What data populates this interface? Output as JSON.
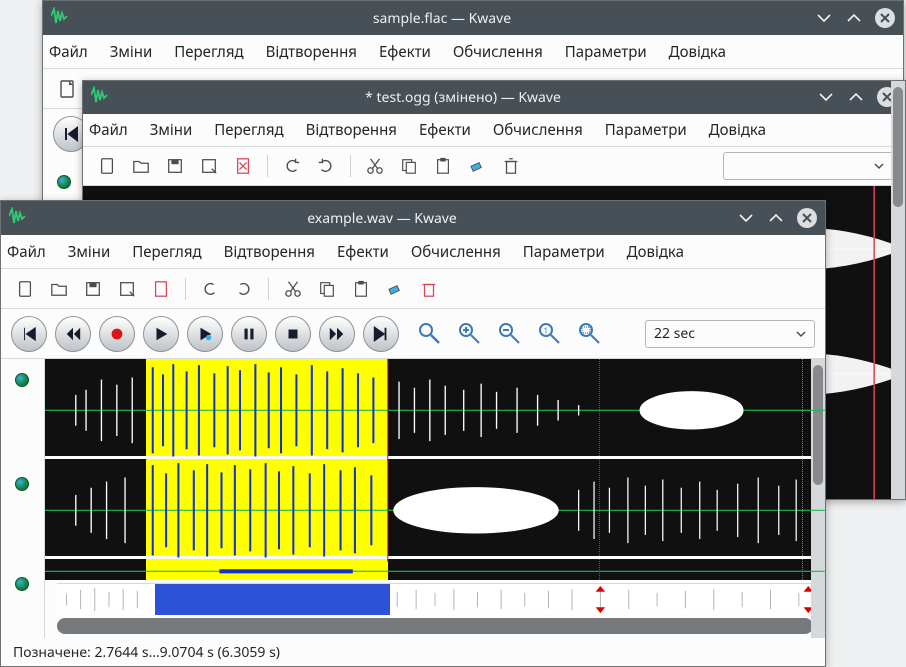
{
  "icons": {
    "logo": "waveform-app",
    "min": "minimize",
    "max": "maximize",
    "close": "close"
  },
  "windows": {
    "back1": {
      "title": "sample.flac — Kwave",
      "menus": [
        "Файл",
        "Зміни",
        "Перегляд",
        "Відтворення",
        "Ефекти",
        "Обчислення",
        "Параметри",
        "Довідка"
      ]
    },
    "back2": {
      "title": "* test.ogg (змінено) — Kwave",
      "menus": [
        "Файл",
        "Зміни",
        "Перегляд",
        "Відтворення",
        "Ефекти",
        "Обчислення",
        "Параметри",
        "Довідка"
      ]
    },
    "front": {
      "title": "example.wav — Kwave",
      "menus": [
        "Файл",
        "Зміни",
        "Перегляд",
        "Відтворення",
        "Ефекти",
        "Обчислення",
        "Параметри",
        "Довідка"
      ],
      "zoom_value": "22 sec",
      "status": "Позначене: 2.7644 s…9.0704 s (6.3059 s)"
    }
  },
  "toolbar_icons": [
    "new",
    "open",
    "save",
    "save-as",
    "close-file",
    "undo",
    "redo",
    "cut",
    "copy",
    "paste",
    "eraser",
    "delete"
  ],
  "play_icons": [
    "skip-start",
    "rewind",
    "record",
    "play",
    "play-loop",
    "pause",
    "stop",
    "forward",
    "skip-end"
  ],
  "zoom_icons": [
    "zoom-select",
    "zoom-in",
    "zoom-out",
    "zoom-one",
    "zoom-fit"
  ],
  "selection": {
    "start_pct": 13,
    "end_pct": 44,
    "start_s": 2.7644,
    "end_s": 9.0704,
    "len_s": 6.3059
  },
  "markers_pct": [
    71,
    97
  ]
}
